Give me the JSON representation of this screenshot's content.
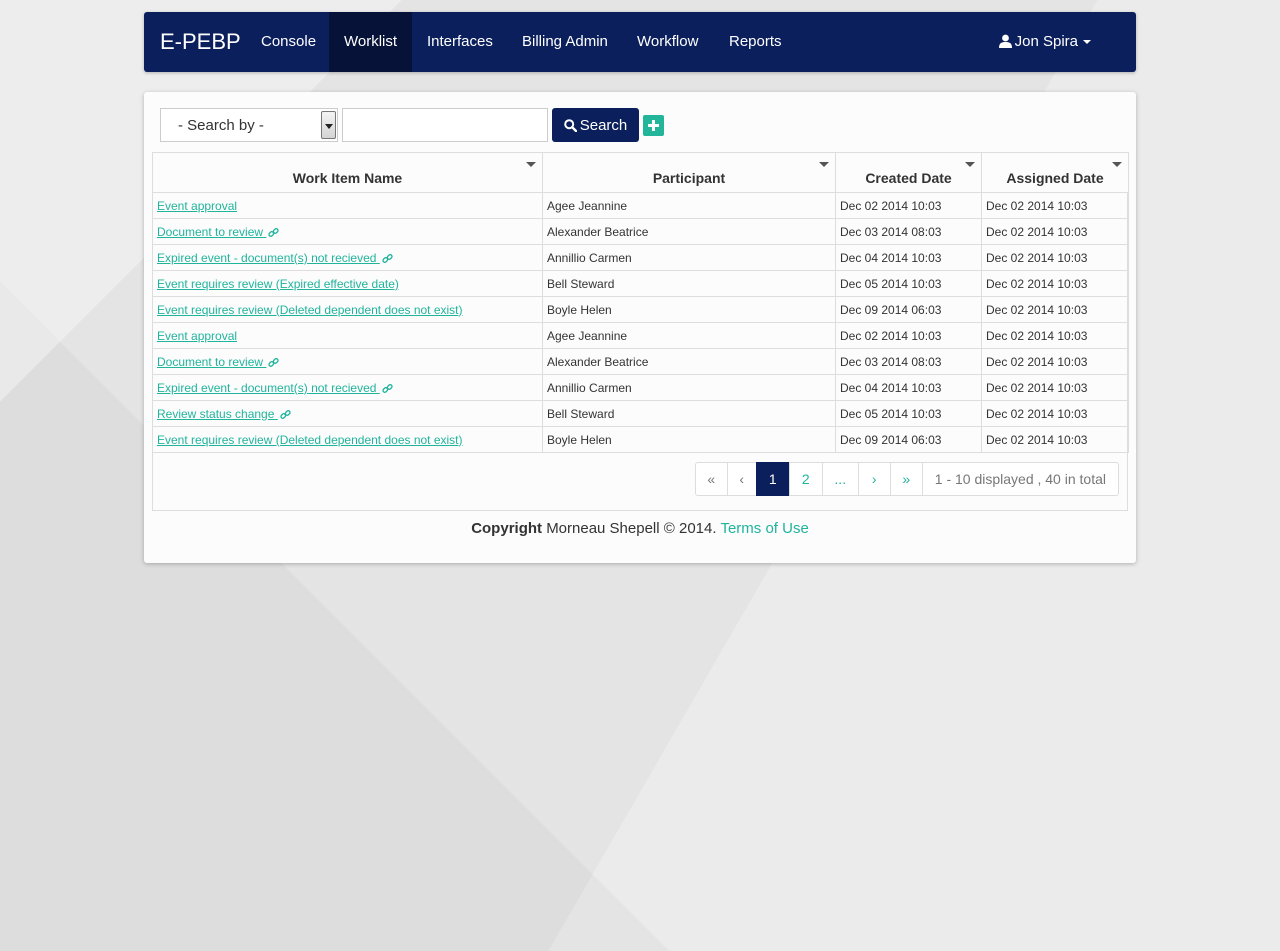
{
  "navbar": {
    "brand": "E-PEBP",
    "items": [
      {
        "label": "Console"
      },
      {
        "label": "Worklist"
      },
      {
        "label": "Interfaces"
      },
      {
        "label": "Billing Admin"
      },
      {
        "label": "Workflow"
      },
      {
        "label": "Reports"
      }
    ],
    "active_item": "Worklist",
    "user_name": "Jon Spira"
  },
  "search": {
    "select_value": "- Search by -",
    "input_value": "",
    "button_label": "Search"
  },
  "table": {
    "columns": [
      "Work Item Name",
      "Participant",
      "Created Date",
      "Assigned Date"
    ],
    "rows": [
      {
        "name": "Event approval",
        "linked": false,
        "participant": "Agee Jeannine",
        "created": "Dec 02 2014 10:03",
        "assigned": "Dec 02 2014 10:03"
      },
      {
        "name": "Document to review",
        "linked": true,
        "participant": "Alexander Beatrice",
        "created": "Dec 03 2014 08:03",
        "assigned": "Dec 02 2014 10:03"
      },
      {
        "name": "Expired event - document(s) not recieved",
        "linked": true,
        "participant": "Annillio Carmen",
        "created": "Dec 04 2014 10:03",
        "assigned": "Dec 02 2014 10:03"
      },
      {
        "name": "Event requires review (Expired effective date)",
        "linked": false,
        "participant": "Bell Steward",
        "created": "Dec 05 2014 10:03",
        "assigned": "Dec 02 2014 10:03"
      },
      {
        "name": "Event requires review (Deleted dependent does not exist)",
        "linked": false,
        "participant": "Boyle Helen",
        "created": "Dec 09 2014 06:03",
        "assigned": "Dec 02 2014 10:03"
      },
      {
        "name": "Event approval",
        "linked": false,
        "participant": "Agee Jeannine",
        "created": "Dec 02 2014 10:03",
        "assigned": "Dec 02 2014 10:03"
      },
      {
        "name": "Document to review",
        "linked": true,
        "participant": "Alexander Beatrice",
        "created": "Dec 03 2014 08:03",
        "assigned": "Dec 02 2014 10:03"
      },
      {
        "name": "Expired event - document(s) not recieved",
        "linked": true,
        "participant": "Annillio Carmen",
        "created": "Dec 04 2014 10:03",
        "assigned": "Dec 02 2014 10:03"
      },
      {
        "name": "Review status change",
        "linked": true,
        "participant": "Bell Steward",
        "created": "Dec 05 2014 10:03",
        "assigned": "Dec 02 2014 10:03"
      },
      {
        "name": "Event requires review (Deleted dependent does not exist)",
        "linked": false,
        "participant": "Boyle Helen",
        "created": "Dec 09 2014 06:03",
        "assigned": "Dec 02 2014 10:03"
      }
    ]
  },
  "pagination": {
    "first": "«",
    "prev": "‹",
    "pages": [
      "1",
      "2",
      "..."
    ],
    "current_page": "1",
    "next": "›",
    "last": "»",
    "info": "1 - 10 displayed , 40 in total"
  },
  "footer": {
    "copyright_label": "Copyright",
    "copyright_text": "Morneau Shepell © 2014.",
    "terms_link": "Terms of Use"
  },
  "colors": {
    "navbar": "#0b1f5c",
    "accent": "#20b49c",
    "add_button": "#22b59a"
  },
  "icons": {
    "user": "user-icon",
    "search": "search-icon",
    "add": "plus-icon",
    "link": "link-icon"
  }
}
